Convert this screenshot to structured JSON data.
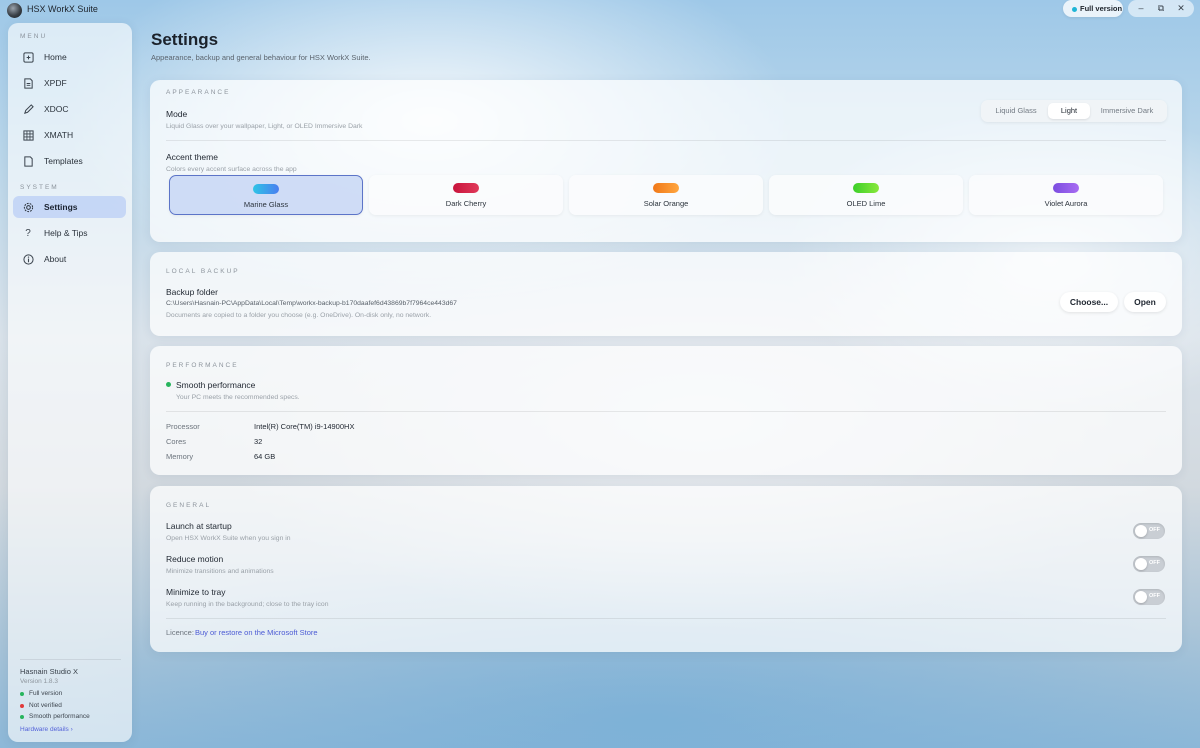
{
  "titlebar": {
    "app_title": "HSX WorkX Suite",
    "version_pill": "Full version",
    "minimize": "–",
    "restore": "⧉",
    "close": "✕"
  },
  "sidebar": {
    "menu_label": "MENU",
    "system_label": "SYSTEM",
    "menu_items": [
      {
        "label": "Home",
        "icon": "home-icon"
      },
      {
        "label": "XPDF",
        "icon": "pdf-icon"
      },
      {
        "label": "XDOC",
        "icon": "pen-icon"
      },
      {
        "label": "XMATH",
        "icon": "grid-icon"
      },
      {
        "label": "Templates",
        "icon": "document-icon"
      }
    ],
    "system_items": [
      {
        "label": "Settings",
        "icon": "gear-icon",
        "active": true
      },
      {
        "label": "Help & Tips",
        "icon": "question-icon"
      },
      {
        "label": "About",
        "icon": "info-icon"
      }
    ],
    "brand": "Hasnain Studio X",
    "version": "Version 1.8.3",
    "statuses": [
      {
        "label": "Full version",
        "color": "#27b45d"
      },
      {
        "label": "Not verified",
        "color": "#e03a3a"
      },
      {
        "label": "Smooth performance",
        "color": "#27b45d"
      }
    ],
    "hardware_link": "Hardware details ›"
  },
  "page": {
    "title": "Settings",
    "subtitle": "Appearance, backup and general behaviour for HSX WorkX Suite."
  },
  "appearance": {
    "heading": "APPEARANCE",
    "mode_title": "Mode",
    "mode_desc": "Liquid Glass over your wallpaper, Light, or OLED Immersive Dark",
    "mode_options": [
      "Liquid Glass",
      "Light",
      "Immersive Dark"
    ],
    "mode_selected": "Light",
    "accent_title": "Accent theme",
    "accent_desc": "Colors every accent surface across the app",
    "accents": [
      {
        "label": "Marine Glass",
        "from": "#2ec4e6",
        "to": "#4a7ef0",
        "active": true
      },
      {
        "label": "Dark Cherry",
        "from": "#c8143c",
        "to": "#e03a5a"
      },
      {
        "label": "Solar Orange",
        "from": "#f07818",
        "to": "#ffa640"
      },
      {
        "label": "OLED Lime",
        "from": "#3ccf2a",
        "to": "#8ae83c"
      },
      {
        "label": "Violet Aurora",
        "from": "#7b4de0",
        "to": "#a86cf2"
      }
    ]
  },
  "backup": {
    "heading": "LOCAL BACKUP",
    "title": "Backup folder",
    "path": "C:\\Users\\Hasnain-PC\\AppData\\Local\\Temp\\workx-backup-b170daafef6d43869b7f7964ce443d67",
    "desc": "Documents are copied to a folder you choose (e.g. OneDrive). On-disk only, no network.",
    "choose_label": "Choose...",
    "open_label": "Open"
  },
  "performance": {
    "heading": "PERFORMANCE",
    "status_title": "Smooth performance",
    "status_desc": "Your PC meets the recommended specs.",
    "status_color": "#27b45d",
    "specs": [
      {
        "key": "Processor",
        "value": "Intel(R) Core(TM) i9-14900HX"
      },
      {
        "key": "Cores",
        "value": "32"
      },
      {
        "key": "Memory",
        "value": "64 GB"
      }
    ]
  },
  "general": {
    "heading": "GENERAL",
    "toggles": [
      {
        "title": "Launch at startup",
        "desc": "Open HSX WorkX Suite when you sign in",
        "state": "OFF"
      },
      {
        "title": "Reduce motion",
        "desc": "Minimize transitions and animations",
        "state": "OFF"
      },
      {
        "title": "Minimize to tray",
        "desc": "Keep running in the background; close to the tray icon",
        "state": "OFF"
      }
    ],
    "licence_label": "Licence:",
    "licence_link": "Buy or restore on the Microsoft Store"
  }
}
